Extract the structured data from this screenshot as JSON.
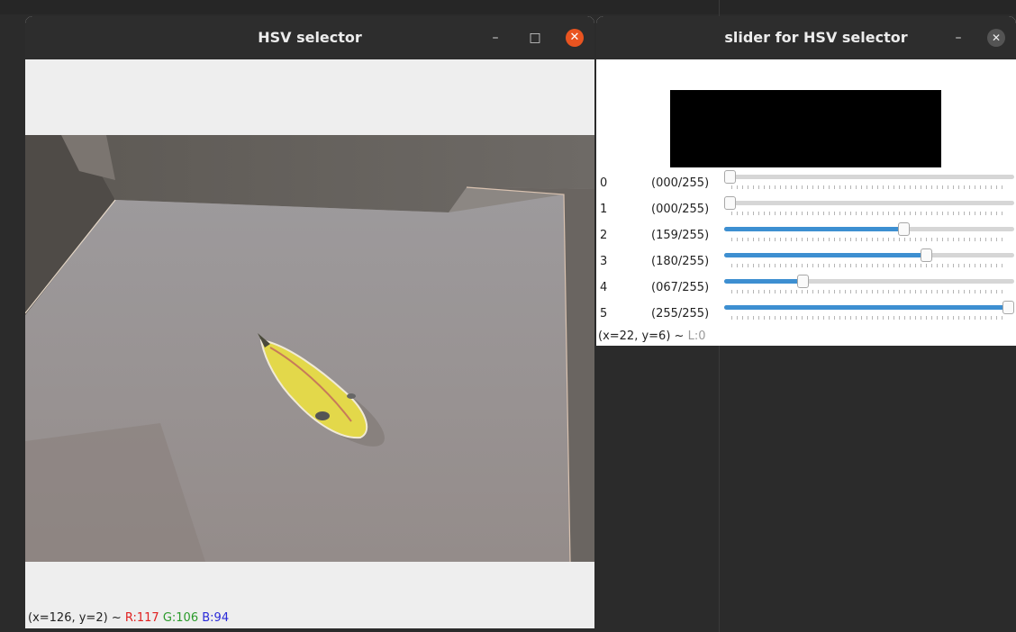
{
  "window_main": {
    "title": "HSV selector",
    "minimize": "–",
    "maximize": "□",
    "close": "✕",
    "status": {
      "coords": "(x=126, y=2)",
      "sep": "~",
      "r": "R:117",
      "g": "G:106",
      "b": "B:94"
    }
  },
  "window_slider": {
    "title": "slider for HSV selector",
    "minimize": "–",
    "close": "✕",
    "sliders": [
      {
        "index": "0",
        "label": "(000/255)",
        "value": 0
      },
      {
        "index": "1",
        "label": "(000/255)",
        "value": 0
      },
      {
        "index": "2",
        "label": "(159/255)",
        "value": 159
      },
      {
        "index": "3",
        "label": "(180/255)",
        "value": 180
      },
      {
        "index": "4",
        "label": "(067/255)",
        "value": 67
      },
      {
        "index": "5",
        "label": "(255/255)",
        "value": 255
      }
    ],
    "slider_max": 255,
    "status": {
      "coords": "(x=22, y=6)",
      "sep": "~",
      "l": "L:0"
    }
  },
  "colors": {
    "accent": "#3d8fd1",
    "close_button": "#e95420"
  }
}
